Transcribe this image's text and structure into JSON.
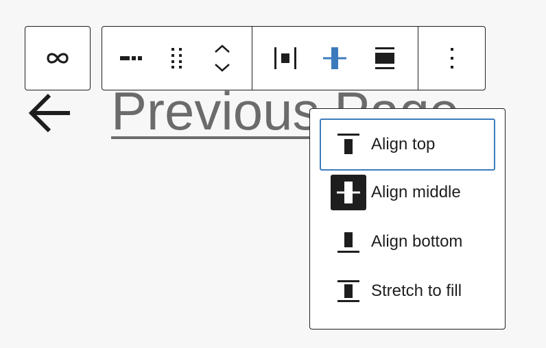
{
  "background": {
    "back_arrow_icon": "arrow-left",
    "link_text": "Previous Page"
  },
  "toolbar": {
    "transform_icon": "link-infinity",
    "move_group": [
      "ellipsis-dash",
      "drag-handle",
      "move-up-down-chevrons"
    ],
    "align_group": [
      "justify-space-between",
      "align-middle",
      "align-stretch"
    ],
    "active_align": "align-middle",
    "more_icon": "vertical-ellipsis",
    "accent_color": "#3b7bbd"
  },
  "menu": {
    "items": [
      {
        "label": "Align top",
        "icon": "align-top",
        "focused": true,
        "active": false
      },
      {
        "label": "Align middle",
        "icon": "align-middle",
        "focused": false,
        "active": true
      },
      {
        "label": "Align bottom",
        "icon": "align-bottom",
        "focused": false,
        "active": false
      },
      {
        "label": "Stretch to fill",
        "icon": "stretch-to-fill",
        "focused": false,
        "active": false
      }
    ]
  }
}
